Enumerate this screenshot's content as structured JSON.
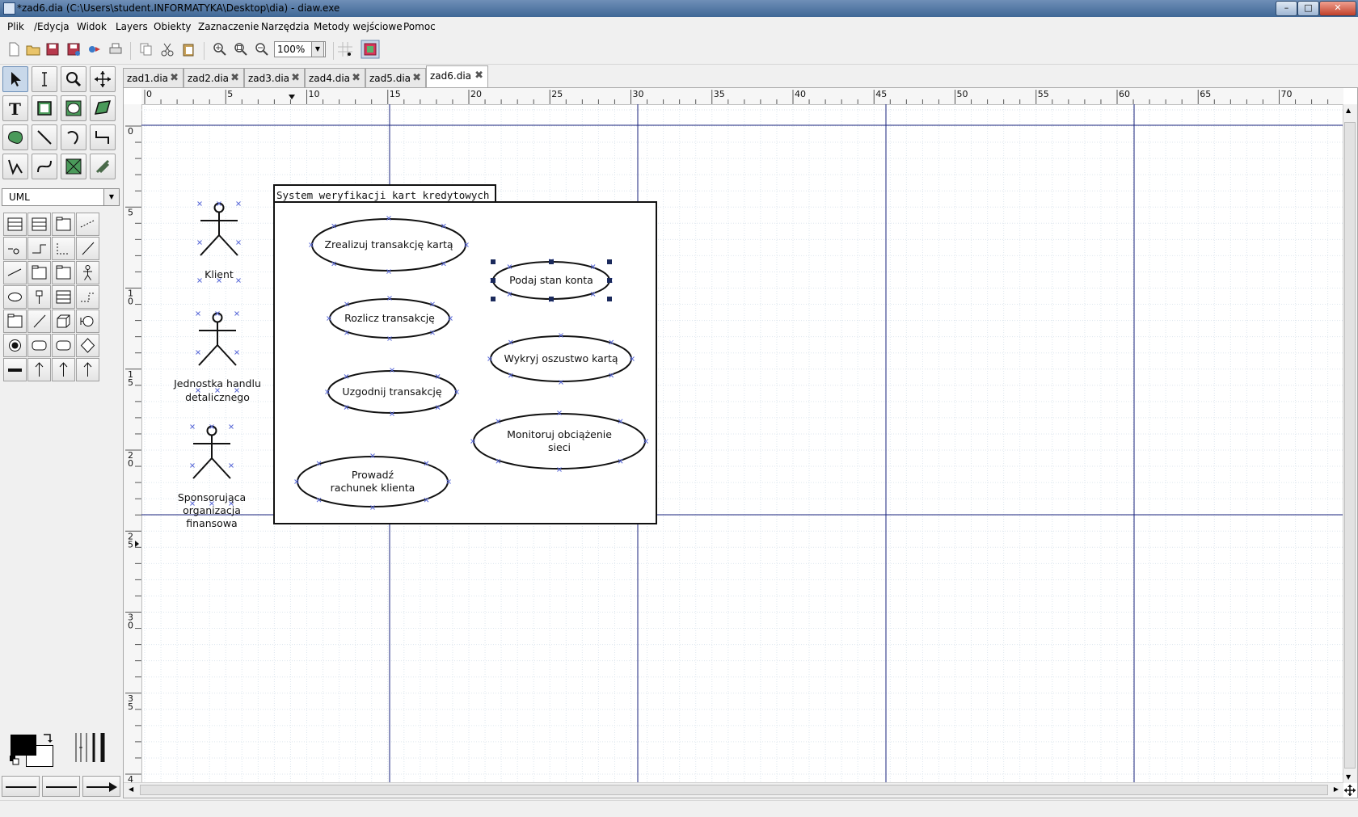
{
  "window": {
    "title": "*zad6.dia (C:\\Users\\student.INFORMATYKA\\Desktop\\dia) - diaw.exe",
    "controls": [
      "minimize",
      "maximize",
      "close"
    ]
  },
  "menu": [
    "Plik",
    "/Edycja",
    "Widok",
    "Layers",
    "Obiekty",
    "Zaznaczenie",
    "Narzędzia",
    "Metody wejściowe",
    "Pomoc"
  ],
  "toolbar": {
    "zoom_value": "100%",
    "icons": [
      "new-file-icon",
      "open-file-icon",
      "save-icon",
      "save-as-icon",
      "export-icon",
      "print-icon",
      "copy-icon",
      "cut-icon",
      "paste-icon",
      "zoom-in-icon",
      "zoom-fit-icon",
      "zoom-out-icon",
      "snap-to-grid-icon",
      "object-snap-icon"
    ]
  },
  "toolbox": {
    "sheet": "UML",
    "tools": [
      "pointer-tool",
      "text-edit-tool",
      "magnify-tool",
      "scroll-tool",
      "text-tool",
      "box-tool",
      "ellipse-tool",
      "polygon-tool",
      "beziergon-tool",
      "line-tool",
      "arc-tool",
      "zigzag-tool",
      "polyline-tool",
      "bezier-tool",
      "image-tool",
      "outline-tool"
    ],
    "uml_shapes": [
      "class-shape",
      "template-class-shape",
      "note-shape",
      "dependency-shape",
      "realizes-shape",
      "generalization-shape",
      "association-shape",
      "implements-shape",
      "constraint-shape",
      "small-package-shape",
      "large-package-shape",
      "actor-shape",
      "use-case-shape",
      "lifeline-shape",
      "object-shape",
      "message-shape",
      "component-shape",
      "component-feature-shape",
      "node-shape",
      "classicon-shape",
      "state-term-shape",
      "state-shape",
      "activity-shape",
      "branch-shape",
      "fork-shape",
      "transition-shape",
      "other-shape",
      "interface-shape"
    ]
  },
  "tabs": [
    {
      "label": "zad1.dia",
      "active": false
    },
    {
      "label": "zad2.dia",
      "active": false
    },
    {
      "label": "zad3.dia",
      "active": false
    },
    {
      "label": "zad4.dia",
      "active": false
    },
    {
      "label": "zad5.dia",
      "active": false
    },
    {
      "label": "zad6.dia",
      "active": true
    }
  ],
  "rulers": {
    "horizontal": [
      "0",
      "5",
      "10",
      "15",
      "20",
      "25",
      "30",
      "35",
      "40",
      "45",
      "50",
      "55",
      "60",
      "65",
      "70"
    ],
    "vertical": [
      "0",
      "5",
      "10",
      "15",
      "20",
      "25",
      "30",
      "35",
      "40"
    ]
  },
  "diagram": {
    "system_title": "System weryfikacji kart kredytowych",
    "actors": [
      {
        "id": "klient",
        "label": [
          "Klient"
        ]
      },
      {
        "id": "jednostka",
        "label": [
          "Jednostka handlu",
          "detalicznego"
        ]
      },
      {
        "id": "sponsor",
        "label": [
          "Sponsorująca",
          "organizacja",
          "finansowa"
        ]
      }
    ],
    "use_cases": [
      {
        "id": "uc1",
        "label": [
          "Zrealizuj transakcję kartą"
        ],
        "selected": false
      },
      {
        "id": "uc2",
        "label": [
          "Podaj stan konta"
        ],
        "selected": true
      },
      {
        "id": "uc3",
        "label": [
          "Rozlicz transakcję"
        ],
        "selected": false
      },
      {
        "id": "uc4",
        "label": [
          "Wykryj oszustwo kartą"
        ],
        "selected": false
      },
      {
        "id": "uc5",
        "label": [
          "Uzgodnij transakcję"
        ],
        "selected": false
      },
      {
        "id": "uc6",
        "label": [
          "Monitoruj obciążenie",
          "sieci"
        ],
        "selected": false
      },
      {
        "id": "uc7",
        "label": [
          "Prowadź",
          "rachunek klienta"
        ],
        "selected": false
      }
    ]
  },
  "colors": {
    "guide_line": "#1a237e",
    "grid": "#dde6ee",
    "connection_point": "#5a6ad8",
    "handle": "#1b2a5c",
    "titlebar": "#4f76a6"
  }
}
